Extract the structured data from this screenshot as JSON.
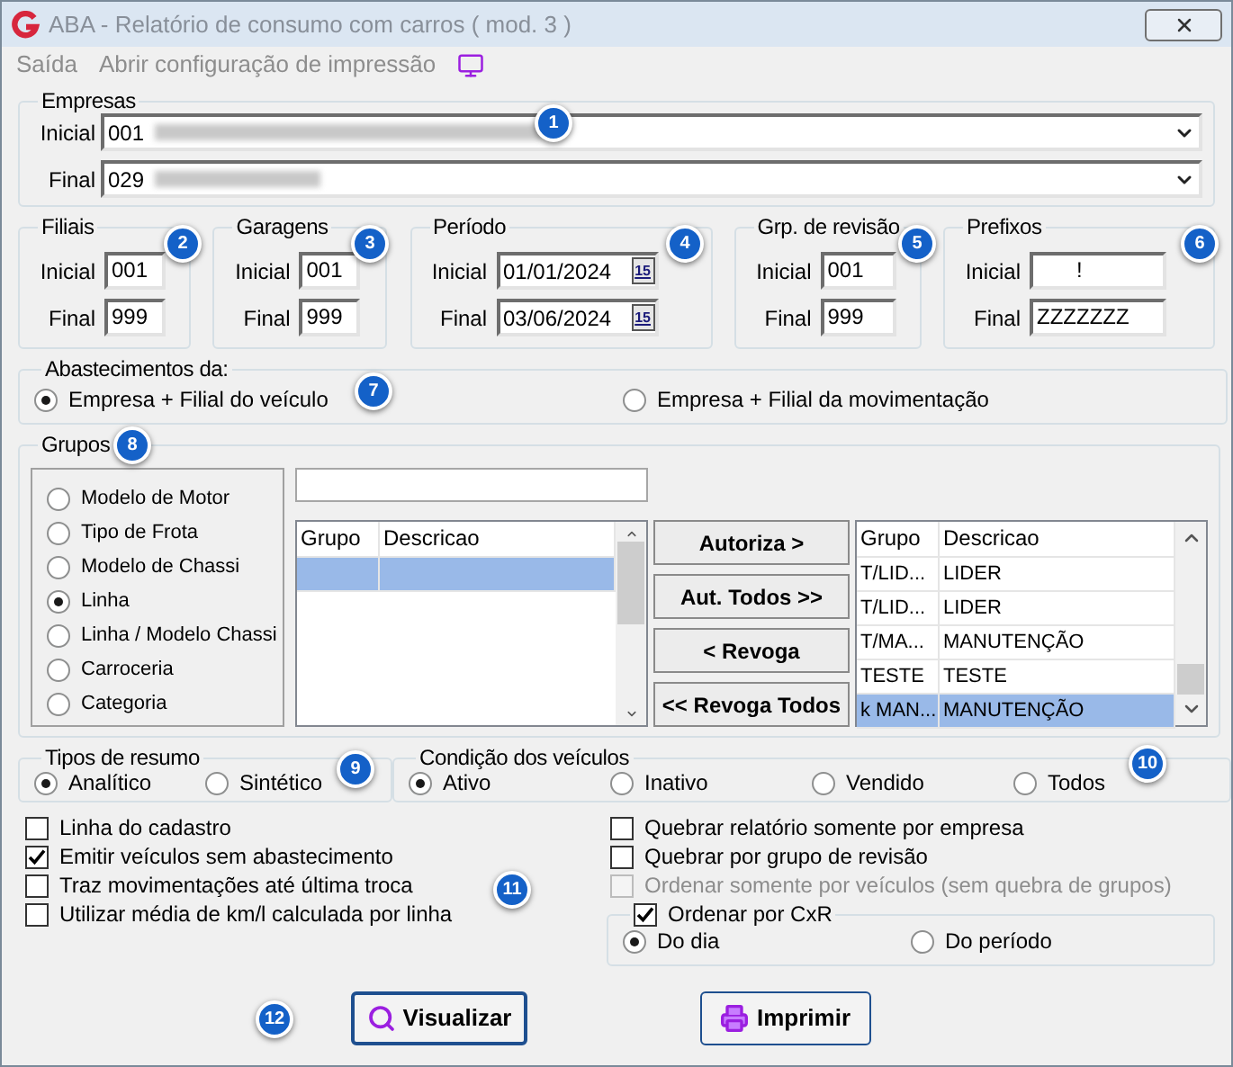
{
  "window": {
    "title": "ABA - Relatório de consumo com carros ( mod. 3 )"
  },
  "menu": [
    {
      "label": "Saída",
      "disabled": true
    },
    {
      "label": "Abrir configuração de impressão",
      "disabled": true
    }
  ],
  "empresas": {
    "title": "Empresas",
    "rows": [
      {
        "label": "Inicial",
        "value": "001"
      },
      {
        "label": "Final",
        "value": "029"
      }
    ]
  },
  "ranges": [
    {
      "title": "Filiais",
      "kind": "text",
      "rows": [
        {
          "label": "Inicial",
          "value": "001"
        },
        {
          "label": "Final",
          "value": "999"
        }
      ]
    },
    {
      "title": "Garagens",
      "kind": "text",
      "rows": [
        {
          "label": "Inicial",
          "value": "001"
        },
        {
          "label": "Final",
          "value": "999"
        }
      ]
    },
    {
      "title": "Período",
      "kind": "date",
      "rows": [
        {
          "label": "Inicial",
          "value": "01/01/2024",
          "button": "15"
        },
        {
          "label": "Final",
          "value": "03/06/2024",
          "button": "15"
        }
      ]
    },
    {
      "title": "Grp. de revisão",
      "kind": "text",
      "rows": [
        {
          "label": "Inicial",
          "value": "001"
        },
        {
          "label": "Final",
          "value": "999"
        }
      ]
    },
    {
      "title": "Prefixos",
      "kind": "wide",
      "rows": [
        {
          "label": "Inicial",
          "value": "!"
        },
        {
          "label": "Final",
          "value": "ZZZZZZZ"
        }
      ]
    }
  ],
  "abastecimentos": {
    "title": "Abastecimentos da:",
    "options": [
      {
        "label": "Empresa + Filial do veículo",
        "selected": true
      },
      {
        "label": "Empresa + Filial da movimentação",
        "selected": false
      }
    ]
  },
  "grupos": {
    "title": "Grupos",
    "types": [
      {
        "label": "Modelo de Motor",
        "selected": false
      },
      {
        "label": "Tipo de Frota",
        "selected": false
      },
      {
        "label": "Modelo de Chassi",
        "selected": false
      },
      {
        "label": "Linha",
        "selected": true
      },
      {
        "label": "Linha / Modelo Chassi",
        "selected": false
      },
      {
        "label": "Carroceria",
        "selected": false
      },
      {
        "label": "Categoria",
        "selected": false
      }
    ],
    "left_table": {
      "columns": [
        "Grupo",
        "Descricao"
      ],
      "rows": [
        {
          "selected": true
        }
      ]
    },
    "buttons": [
      "Autoriza >",
      "Aut. Todos >>",
      "< Revoga",
      "<< Revoga Todos"
    ],
    "right_table": {
      "columns": [
        "Grupo",
        "Descricao"
      ],
      "rows": [
        {
          "cells": [
            "T/LID...",
            "LIDER"
          ],
          "selected": false
        },
        {
          "cells": [
            "T/LID...",
            "LIDER"
          ],
          "selected": false
        },
        {
          "cells": [
            "T/MA...",
            "MANUTENÇÃO"
          ],
          "selected": false
        },
        {
          "cells": [
            "TESTE",
            "TESTE"
          ],
          "selected": false
        },
        {
          "cells": [
            "k MAN...",
            "MANUTENÇÃO"
          ],
          "selected": true
        }
      ]
    }
  },
  "resumo": {
    "title": "Tipos de resumo",
    "options": [
      {
        "label": "Analítico",
        "selected": true
      },
      {
        "label": "Sintético",
        "selected": false
      }
    ]
  },
  "condicao": {
    "title": "Condição dos veículos",
    "options": [
      {
        "label": "Ativo",
        "selected": true
      },
      {
        "label": "Inativo",
        "selected": false
      },
      {
        "label": "Vendido",
        "selected": false
      },
      {
        "label": "Todos",
        "selected": false
      }
    ]
  },
  "options_left": [
    {
      "label": "Linha do cadastro",
      "checked": false,
      "disabled": false
    },
    {
      "label": "Emitir veículos sem abastecimento",
      "checked": true,
      "disabled": false
    },
    {
      "label": "Traz movimentações até última troca",
      "checked": false,
      "disabled": false
    },
    {
      "label": "Utilizar média de km/l calculada por linha",
      "checked": false,
      "disabled": false
    }
  ],
  "options_right": [
    {
      "label": "Quebrar relatório somente por empresa",
      "checked": false,
      "disabled": false
    },
    {
      "label": "Quebrar por grupo de revisão",
      "checked": false,
      "disabled": false
    },
    {
      "label": "Ordenar somente por veículos (sem quebra de grupos)",
      "checked": false,
      "disabled": true
    }
  ],
  "ordenar": {
    "label": "Ordenar por CxR",
    "checked": true,
    "options": [
      {
        "label": "Do dia",
        "selected": true
      },
      {
        "label": "Do período",
        "selected": false
      }
    ]
  },
  "actions": [
    {
      "label": "Visualizar",
      "kind": "view"
    },
    {
      "label": "Imprimir",
      "kind": "print"
    }
  ],
  "callouts": [
    "1",
    "2",
    "3",
    "4",
    "5",
    "6",
    "7",
    "8",
    "9",
    "10",
    "11",
    "12"
  ]
}
